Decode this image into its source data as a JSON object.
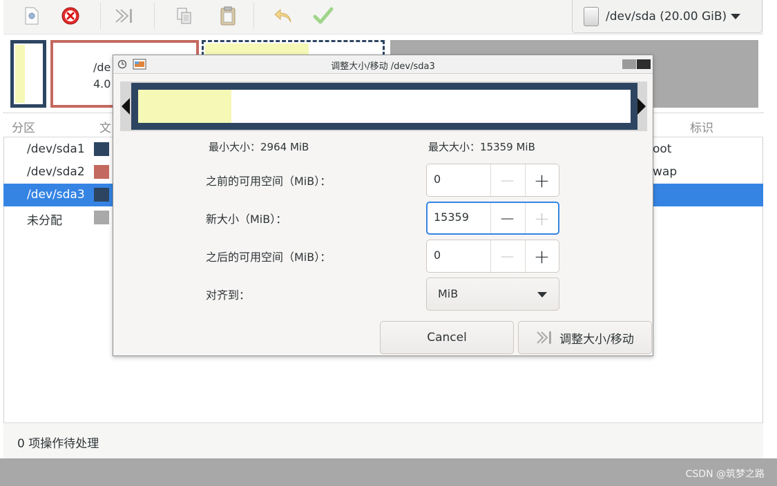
{
  "toolbar": {
    "buttons": [
      {
        "name": "new",
        "icon": "new-document-icon"
      },
      {
        "name": "delete",
        "icon": "delete-icon"
      },
      {
        "name": "resize-move",
        "icon": "resize-move-icon"
      },
      {
        "name": "copy",
        "icon": "copy-icon"
      },
      {
        "name": "paste",
        "icon": "paste-icon"
      },
      {
        "name": "undo",
        "icon": "undo-icon"
      },
      {
        "name": "apply",
        "icon": "apply-icon"
      }
    ],
    "device": "/dev/sda (20.00 GiB)"
  },
  "graph": {
    "partial_label_1": "/de",
    "partial_label_2": "4.0"
  },
  "list": {
    "headers": {
      "partition": "分区",
      "filesystem": "文",
      "label": "标识"
    },
    "rows": [
      {
        "name": "/dev/sda1",
        "color": "#2d4561",
        "label": "oot"
      },
      {
        "name": "/dev/sda2",
        "color": "#c4695f",
        "label": "wap"
      },
      {
        "name": "/dev/sda3",
        "color": "#2d4561",
        "label": ""
      },
      {
        "name": "未分配",
        "color": "#a9a9a9",
        "label": ""
      }
    ]
  },
  "status": "0 项操作待处理",
  "watermark": "CSDN @筑梦之路",
  "dialog": {
    "title": "调整大小/移动 /dev/sda3",
    "min_size": "最小大小：2964 MiB",
    "max_size": "最大大小：15359 MiB",
    "free_before_label": "之前的可用空间（MiB）：",
    "free_before_value": "0",
    "new_size_label": "新大小（MiB）：",
    "new_size_value": "15359",
    "free_after_label": "之后的可用空间（MiB）：",
    "free_after_value": "0",
    "align_label": "对齐到：",
    "align_value": "MiB",
    "cancel": "Cancel",
    "resize": "调整大小/移动",
    "used_fraction": 0.19
  },
  "colors": {
    "accent": "#3584e4",
    "partition_dark": "#2d4561",
    "partition_red": "#c4695f",
    "used_yellow": "#f6f8b6",
    "unallocated": "#a9a9a9"
  }
}
